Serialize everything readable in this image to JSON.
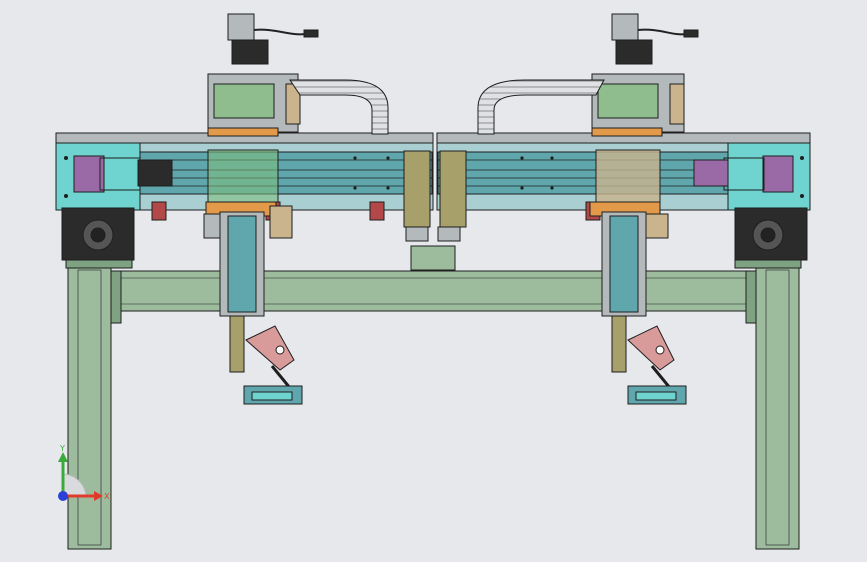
{
  "viewport": {
    "background": "#e6e8ec"
  },
  "colors": {
    "outline": "#1e1e1e",
    "frame": "#9dbc9e",
    "frame_dark": "#7fa283",
    "beam_top": "#a9cfd2",
    "beam": "#5fa7ad",
    "beam_dark": "#3f8389",
    "end_plate": "#6fd3cf",
    "purple": "#9a6aa6",
    "green_block": "#7fbf7a",
    "orange": "#e29a4a",
    "motor": "#2b2b2b",
    "tan": "#c9b48d",
    "steel": "#b4b9bc",
    "olive": "#a7a06a",
    "pink": "#d99a9a",
    "red": "#b24848"
  },
  "triad": {
    "x_label": "X",
    "y_label": "Y",
    "x_color": "#e23a2a",
    "y_color": "#3aaa3a",
    "z_color": "#2a40d8"
  }
}
